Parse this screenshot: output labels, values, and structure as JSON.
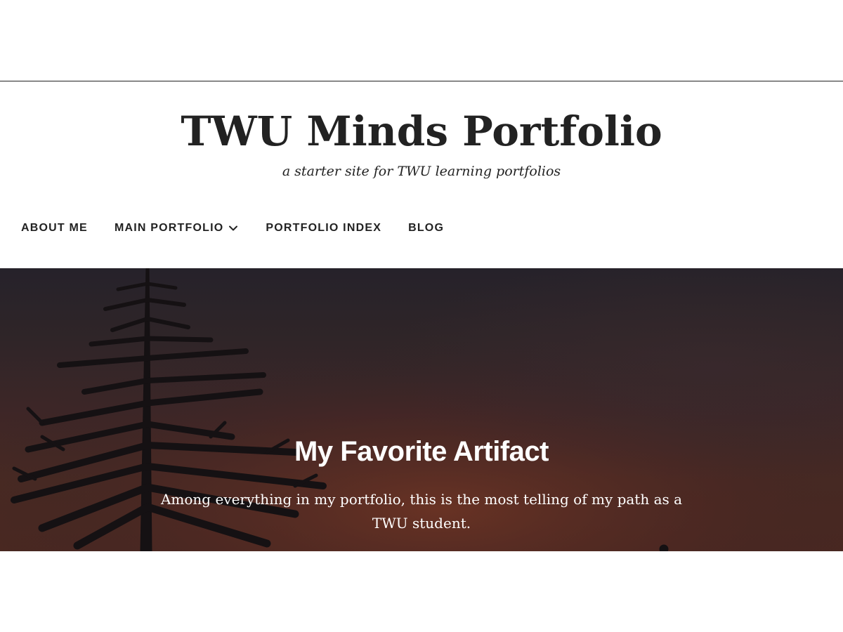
{
  "site": {
    "title": "TWU Minds Portfolio",
    "tagline": "a starter site for TWU learning portfolios"
  },
  "nav": {
    "items": [
      {
        "label": "ABOUT ME",
        "has_submenu": false
      },
      {
        "label": "MAIN PORTFOLIO",
        "has_submenu": true,
        "icon": "chevron-down-icon"
      },
      {
        "label": "PORTFOLIO INDEX",
        "has_submenu": false
      },
      {
        "label": "BLOG",
        "has_submenu": false
      }
    ]
  },
  "hero": {
    "title": "My Favorite Artifact",
    "text": "Among everything in my portfolio, this is the most telling of my path as a TWU student.",
    "background": "sunset-sky-with-evergreen-tree-silhouette"
  },
  "colors": {
    "text": "#222222",
    "hero_text": "#ffffff",
    "hero_sky_top": "#26222a",
    "hero_sky_bottom": "#4c2820"
  }
}
